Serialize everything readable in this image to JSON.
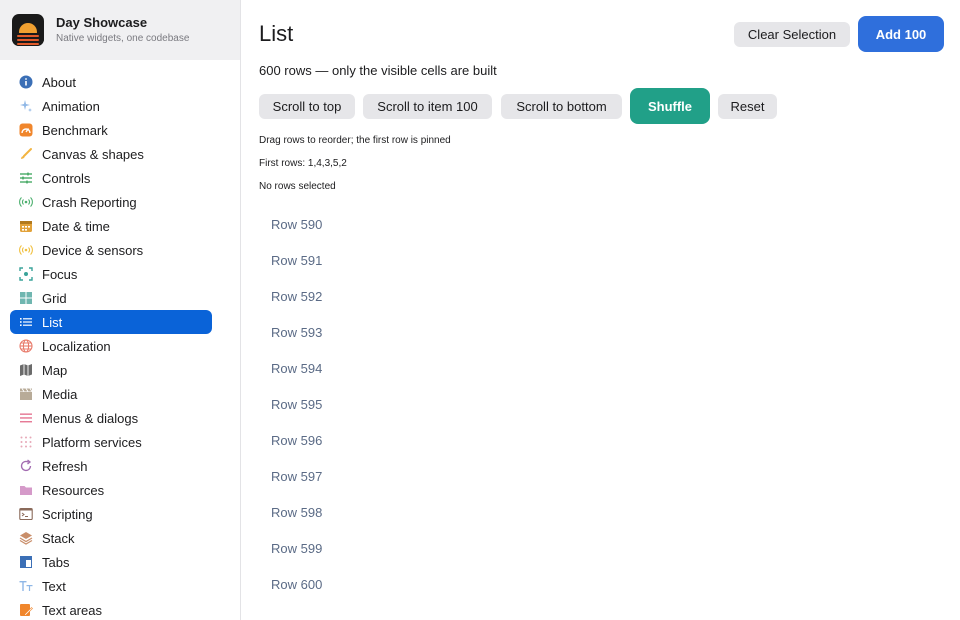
{
  "app": {
    "title": "Day Showcase",
    "subtitle": "Native widgets, one codebase",
    "logo_icon": "sunset-logo-icon"
  },
  "sidebar": {
    "items": [
      {
        "label": "About",
        "icon": "info-icon",
        "color": "#3b6fb6"
      },
      {
        "label": "Animation",
        "icon": "sparkles-icon",
        "color": "#8fb7e6"
      },
      {
        "label": "Benchmark",
        "icon": "gauge-icon",
        "color": "#f0862c"
      },
      {
        "label": "Canvas & shapes",
        "icon": "brush-icon",
        "color": "#f2b441"
      },
      {
        "label": "Controls",
        "icon": "sliders-icon",
        "color": "#3aa35a"
      },
      {
        "label": "Crash Reporting",
        "icon": "broadcast-icon",
        "color": "#4caf6e"
      },
      {
        "label": "Date & time",
        "icon": "calendar-icon",
        "color": "#e2a23a"
      },
      {
        "label": "Device & sensors",
        "icon": "broadcast-icon",
        "color": "#f0c040"
      },
      {
        "label": "Focus",
        "icon": "focus-icon",
        "color": "#3aa39a"
      },
      {
        "label": "Grid",
        "icon": "grid-icon",
        "color": "#6fb6b0"
      },
      {
        "label": "List",
        "icon": "list-icon",
        "color": "#ffffff"
      },
      {
        "label": "Localization",
        "icon": "globe-icon",
        "color": "#e87a6a"
      },
      {
        "label": "Map",
        "icon": "map-icon",
        "color": "#6b6b6b"
      },
      {
        "label": "Media",
        "icon": "clapper-icon",
        "color": "#b8ab98"
      },
      {
        "label": "Menus & dialogs",
        "icon": "menu-lines-icon",
        "color": "#e36b8a"
      },
      {
        "label": "Platform services",
        "icon": "dots-grid-icon",
        "color": "#e7a7b7"
      },
      {
        "label": "Refresh",
        "icon": "refresh-icon",
        "color": "#a26bb0"
      },
      {
        "label": "Resources",
        "icon": "folder-icon",
        "color": "#d59ac9"
      },
      {
        "label": "Scripting",
        "icon": "terminal-icon",
        "color": "#8a6a5a"
      },
      {
        "label": "Stack",
        "icon": "stack-icon",
        "color": "#c98e6a"
      },
      {
        "label": "Tabs",
        "icon": "tabs-icon",
        "color": "#3b6fb6"
      },
      {
        "label": "Text",
        "icon": "text-icon",
        "color": "#8fb7e6"
      },
      {
        "label": "Text areas",
        "icon": "text-area-icon",
        "color": "#f0862c"
      }
    ],
    "active_index": 10,
    "active_color": "#0a63d8"
  },
  "main": {
    "title": "List",
    "clear_selection_label": "Clear Selection",
    "add_label": "Add 100",
    "summary": "600 rows — only the visible cells are built",
    "actions": {
      "scroll_top": "Scroll to top",
      "scroll_item": "Scroll to item 100",
      "scroll_bottom": "Scroll to bottom",
      "shuffle": "Shuffle",
      "reset": "Reset"
    },
    "notes": {
      "drag_hint": "Drag rows to reorder; the first row is pinned",
      "first_rows": "First rows: 1,4,3,5,2",
      "selection": "No rows selected"
    },
    "rows": [
      "Row 590",
      "Row 591",
      "Row 592",
      "Row 593",
      "Row 594",
      "Row 595",
      "Row 596",
      "Row 597",
      "Row 598",
      "Row 599",
      "Row 600"
    ]
  },
  "colors": {
    "accent": "#2f6fdc",
    "shuffle": "#21a088",
    "row_text": "#5b6b86"
  }
}
